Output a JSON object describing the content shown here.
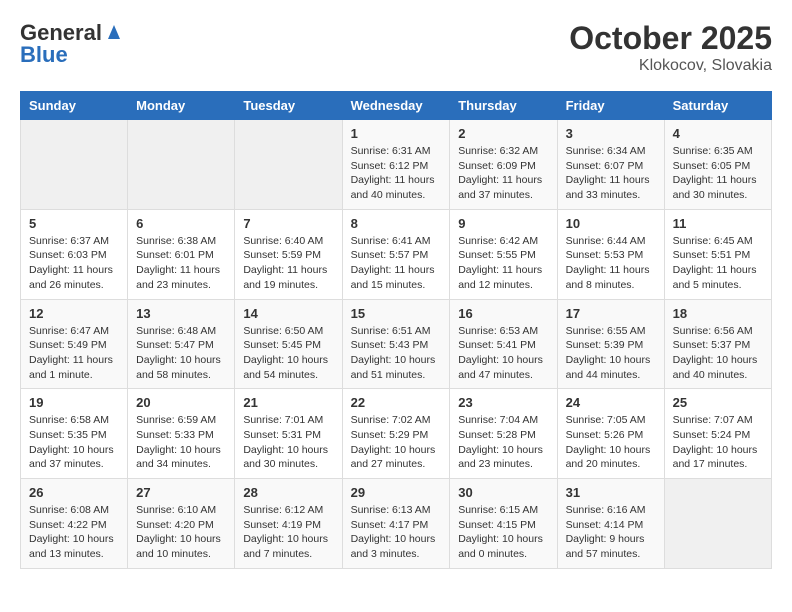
{
  "header": {
    "logo_line1": "General",
    "logo_line2": "Blue",
    "title": "October 2025",
    "subtitle": "Klokocov, Slovakia"
  },
  "days_of_week": [
    "Sunday",
    "Monday",
    "Tuesday",
    "Wednesday",
    "Thursday",
    "Friday",
    "Saturday"
  ],
  "weeks": [
    [
      {
        "day": "",
        "info": ""
      },
      {
        "day": "",
        "info": ""
      },
      {
        "day": "",
        "info": ""
      },
      {
        "day": "1",
        "info": "Sunrise: 6:31 AM\nSunset: 6:12 PM\nDaylight: 11 hours and 40 minutes."
      },
      {
        "day": "2",
        "info": "Sunrise: 6:32 AM\nSunset: 6:09 PM\nDaylight: 11 hours and 37 minutes."
      },
      {
        "day": "3",
        "info": "Sunrise: 6:34 AM\nSunset: 6:07 PM\nDaylight: 11 hours and 33 minutes."
      },
      {
        "day": "4",
        "info": "Sunrise: 6:35 AM\nSunset: 6:05 PM\nDaylight: 11 hours and 30 minutes."
      }
    ],
    [
      {
        "day": "5",
        "info": "Sunrise: 6:37 AM\nSunset: 6:03 PM\nDaylight: 11 hours and 26 minutes."
      },
      {
        "day": "6",
        "info": "Sunrise: 6:38 AM\nSunset: 6:01 PM\nDaylight: 11 hours and 23 minutes."
      },
      {
        "day": "7",
        "info": "Sunrise: 6:40 AM\nSunset: 5:59 PM\nDaylight: 11 hours and 19 minutes."
      },
      {
        "day": "8",
        "info": "Sunrise: 6:41 AM\nSunset: 5:57 PM\nDaylight: 11 hours and 15 minutes."
      },
      {
        "day": "9",
        "info": "Sunrise: 6:42 AM\nSunset: 5:55 PM\nDaylight: 11 hours and 12 minutes."
      },
      {
        "day": "10",
        "info": "Sunrise: 6:44 AM\nSunset: 5:53 PM\nDaylight: 11 hours and 8 minutes."
      },
      {
        "day": "11",
        "info": "Sunrise: 6:45 AM\nSunset: 5:51 PM\nDaylight: 11 hours and 5 minutes."
      }
    ],
    [
      {
        "day": "12",
        "info": "Sunrise: 6:47 AM\nSunset: 5:49 PM\nDaylight: 11 hours and 1 minute."
      },
      {
        "day": "13",
        "info": "Sunrise: 6:48 AM\nSunset: 5:47 PM\nDaylight: 10 hours and 58 minutes."
      },
      {
        "day": "14",
        "info": "Sunrise: 6:50 AM\nSunset: 5:45 PM\nDaylight: 10 hours and 54 minutes."
      },
      {
        "day": "15",
        "info": "Sunrise: 6:51 AM\nSunset: 5:43 PM\nDaylight: 10 hours and 51 minutes."
      },
      {
        "day": "16",
        "info": "Sunrise: 6:53 AM\nSunset: 5:41 PM\nDaylight: 10 hours and 47 minutes."
      },
      {
        "day": "17",
        "info": "Sunrise: 6:55 AM\nSunset: 5:39 PM\nDaylight: 10 hours and 44 minutes."
      },
      {
        "day": "18",
        "info": "Sunrise: 6:56 AM\nSunset: 5:37 PM\nDaylight: 10 hours and 40 minutes."
      }
    ],
    [
      {
        "day": "19",
        "info": "Sunrise: 6:58 AM\nSunset: 5:35 PM\nDaylight: 10 hours and 37 minutes."
      },
      {
        "day": "20",
        "info": "Sunrise: 6:59 AM\nSunset: 5:33 PM\nDaylight: 10 hours and 34 minutes."
      },
      {
        "day": "21",
        "info": "Sunrise: 7:01 AM\nSunset: 5:31 PM\nDaylight: 10 hours and 30 minutes."
      },
      {
        "day": "22",
        "info": "Sunrise: 7:02 AM\nSunset: 5:29 PM\nDaylight: 10 hours and 27 minutes."
      },
      {
        "day": "23",
        "info": "Sunrise: 7:04 AM\nSunset: 5:28 PM\nDaylight: 10 hours and 23 minutes."
      },
      {
        "day": "24",
        "info": "Sunrise: 7:05 AM\nSunset: 5:26 PM\nDaylight: 10 hours and 20 minutes."
      },
      {
        "day": "25",
        "info": "Sunrise: 7:07 AM\nSunset: 5:24 PM\nDaylight: 10 hours and 17 minutes."
      }
    ],
    [
      {
        "day": "26",
        "info": "Sunrise: 6:08 AM\nSunset: 4:22 PM\nDaylight: 10 hours and 13 minutes."
      },
      {
        "day": "27",
        "info": "Sunrise: 6:10 AM\nSunset: 4:20 PM\nDaylight: 10 hours and 10 minutes."
      },
      {
        "day": "28",
        "info": "Sunrise: 6:12 AM\nSunset: 4:19 PM\nDaylight: 10 hours and 7 minutes."
      },
      {
        "day": "29",
        "info": "Sunrise: 6:13 AM\nSunset: 4:17 PM\nDaylight: 10 hours and 3 minutes."
      },
      {
        "day": "30",
        "info": "Sunrise: 6:15 AM\nSunset: 4:15 PM\nDaylight: 10 hours and 0 minutes."
      },
      {
        "day": "31",
        "info": "Sunrise: 6:16 AM\nSunset: 4:14 PM\nDaylight: 9 hours and 57 minutes."
      },
      {
        "day": "",
        "info": ""
      }
    ]
  ]
}
